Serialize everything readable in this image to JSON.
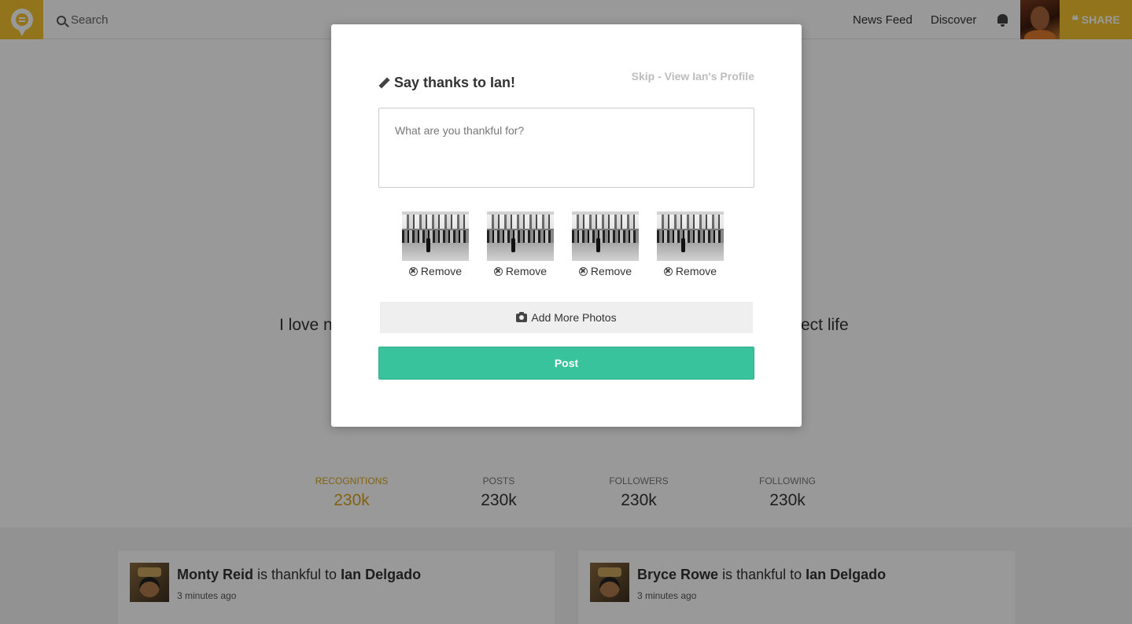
{
  "topbar": {
    "search_placeholder": "Search",
    "nav": [
      "News Feed",
      "Discover"
    ],
    "share_label": "SHARE"
  },
  "profile": {
    "bio_left": "I love n",
    "bio_right": "ect life",
    "stats": [
      {
        "label": "RECOGNITIONS",
        "value": "230k"
      },
      {
        "label": "POSTS",
        "value": "230k"
      },
      {
        "label": "FOLLOWERS",
        "value": "230k"
      },
      {
        "label": "FOLLOWING",
        "value": "230k"
      }
    ]
  },
  "feed": [
    {
      "author": "Monty Reid",
      "verb": "is thankful to",
      "target": "Ian Delgado",
      "time": "3 minutes ago"
    },
    {
      "author": "Bryce Rowe",
      "verb": "is thankful to",
      "target": "Ian Delgado",
      "time": "3 minutes ago"
    }
  ],
  "modal": {
    "title": "Say thanks to Ian!",
    "skip_label": "Skip - View Ian's Profile",
    "input_placeholder": "What are you thankful for?",
    "remove_label": "Remove",
    "add_photos_label": "Add More Photos",
    "post_label": "Post"
  },
  "colors": {
    "brand_yellow": "#f2c22e",
    "post_green": "#38c39c",
    "active_stat": "#d9a41b"
  }
}
